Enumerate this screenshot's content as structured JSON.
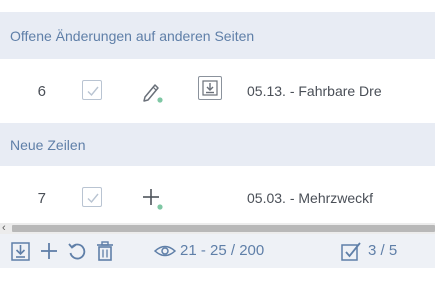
{
  "colors": {
    "header_bg": "#e8ecf4",
    "header_text": "#5f7fa8",
    "accent_blue": "#5f7fa8",
    "green_dot": "#7fc7a4"
  },
  "sections": [
    {
      "header": "Offene Änderungen auf anderen Seiten",
      "rows": [
        {
          "number": "6",
          "checked": true,
          "action_icon": "pencil-icon",
          "extra_icon": "import-box-icon",
          "text": "05.13. - Fahrbare Dre"
        }
      ]
    },
    {
      "header": "Neue Zeilen",
      "rows": [
        {
          "number": "7",
          "checked": true,
          "action_icon": "plus-icon",
          "text": "05.03. - Mehrzweckf"
        }
      ]
    }
  ],
  "toolbar": {
    "buttons": [
      {
        "icon": "import-icon"
      },
      {
        "icon": "add-icon"
      },
      {
        "icon": "undo-icon"
      },
      {
        "icon": "delete-icon"
      }
    ],
    "view_icon": "eye-icon",
    "range": "21 - 25 / 200",
    "checked_icon": "checked-box-icon",
    "checked_count": "3 / 5"
  }
}
